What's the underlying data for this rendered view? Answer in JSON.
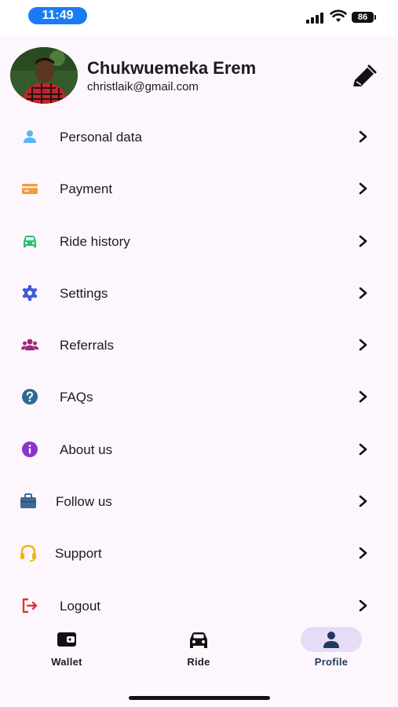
{
  "status_bar": {
    "time": "11:49",
    "battery": "86"
  },
  "profile": {
    "name": "Chukwuemeka Erem",
    "email": "christlaik@gmail.com"
  },
  "menu": [
    {
      "label": "Personal data",
      "icon": "person-icon",
      "color": "#5cb3f5"
    },
    {
      "label": "Payment",
      "icon": "credit-card-icon",
      "color": "#f29b3a"
    },
    {
      "label": "Ride history",
      "icon": "car-icon",
      "color": "#2fbf74"
    },
    {
      "label": "Settings",
      "icon": "gear-icon",
      "color": "#3b5bd9"
    },
    {
      "label": "Referrals",
      "icon": "group-icon",
      "color": "#a0287a"
    },
    {
      "label": "FAQs",
      "icon": "question-icon",
      "color": "#2f6a96"
    },
    {
      "label": "About us",
      "icon": "info-icon",
      "color": "#8b35c8"
    },
    {
      "label": "Follow us",
      "icon": "briefcase-icon",
      "color": "#3e6a98"
    },
    {
      "label": "Support",
      "icon": "headset-icon",
      "color": "#f2b514"
    },
    {
      "label": "Logout",
      "icon": "logout-icon",
      "color": "#d9373a"
    }
  ],
  "bottom_nav": [
    {
      "label": "Wallet",
      "icon": "wallet-icon",
      "active": false
    },
    {
      "label": "Ride",
      "icon": "car-icon",
      "active": false
    },
    {
      "label": "Profile",
      "icon": "person-icon",
      "active": true
    }
  ],
  "colors": {
    "active_pill": "#e7dcf5",
    "active_label": "#1f3a5f",
    "time_pill": "#1a7cf5"
  }
}
